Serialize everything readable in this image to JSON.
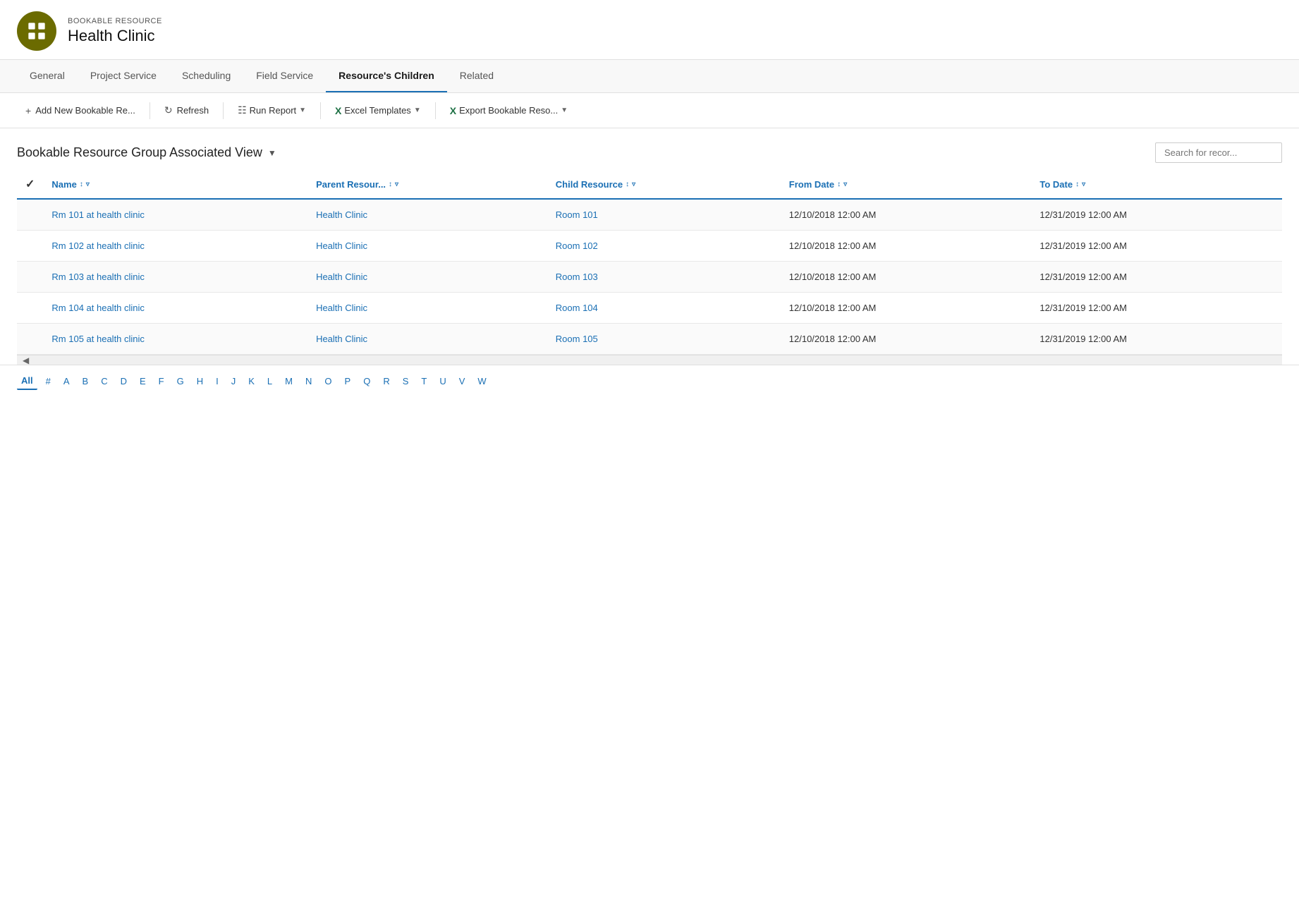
{
  "header": {
    "subtitle": "BOOKABLE RESOURCE",
    "title": "Health Clinic"
  },
  "nav": {
    "tabs": [
      {
        "label": "General",
        "active": false
      },
      {
        "label": "Project Service",
        "active": false
      },
      {
        "label": "Scheduling",
        "active": false
      },
      {
        "label": "Field Service",
        "active": false
      },
      {
        "label": "Resource's Children",
        "active": true
      },
      {
        "label": "Related",
        "active": false
      }
    ]
  },
  "toolbar": {
    "add_label": "Add New Bookable Re...",
    "refresh_label": "Refresh",
    "run_report_label": "Run Report",
    "excel_templates_label": "Excel Templates",
    "export_label": "Export Bookable Reso..."
  },
  "view": {
    "title": "Bookable Resource Group Associated View",
    "search_placeholder": "Search for recor..."
  },
  "table": {
    "columns": [
      {
        "label": "Name",
        "sortable": true,
        "filterable": true
      },
      {
        "label": "Parent Resour...",
        "sortable": true,
        "filterable": true
      },
      {
        "label": "Child Resource",
        "sortable": true,
        "filterable": true
      },
      {
        "label": "From Date",
        "sortable": true,
        "filterable": true
      },
      {
        "label": "To Date",
        "sortable": true,
        "filterable": true
      }
    ],
    "rows": [
      {
        "name": "Rm 101 at health clinic",
        "parent": "Health Clinic",
        "child": "Room 101",
        "from_date": "12/10/2018 12:00 AM",
        "to_date": "12/31/2019 12:00 AM"
      },
      {
        "name": "Rm 102 at health clinic",
        "parent": "Health Clinic",
        "child": "Room 102",
        "from_date": "12/10/2018 12:00 AM",
        "to_date": "12/31/2019 12:00 AM"
      },
      {
        "name": "Rm 103 at health clinic",
        "parent": "Health Clinic",
        "child": "Room 103",
        "from_date": "12/10/2018 12:00 AM",
        "to_date": "12/31/2019 12:00 AM"
      },
      {
        "name": "Rm 104 at health clinic",
        "parent": "Health Clinic",
        "child": "Room 104",
        "from_date": "12/10/2018 12:00 AM",
        "to_date": "12/31/2019 12:00 AM"
      },
      {
        "name": "Rm 105 at health clinic",
        "parent": "Health Clinic",
        "child": "Room 105",
        "from_date": "12/10/2018 12:00 AM",
        "to_date": "12/31/2019 12:00 AM"
      }
    ]
  },
  "alpha_nav": {
    "items": [
      "All",
      "#",
      "A",
      "B",
      "C",
      "D",
      "E",
      "F",
      "G",
      "H",
      "I",
      "J",
      "K",
      "L",
      "M",
      "N",
      "O",
      "P",
      "Q",
      "R",
      "S",
      "T",
      "U",
      "V",
      "W"
    ]
  }
}
